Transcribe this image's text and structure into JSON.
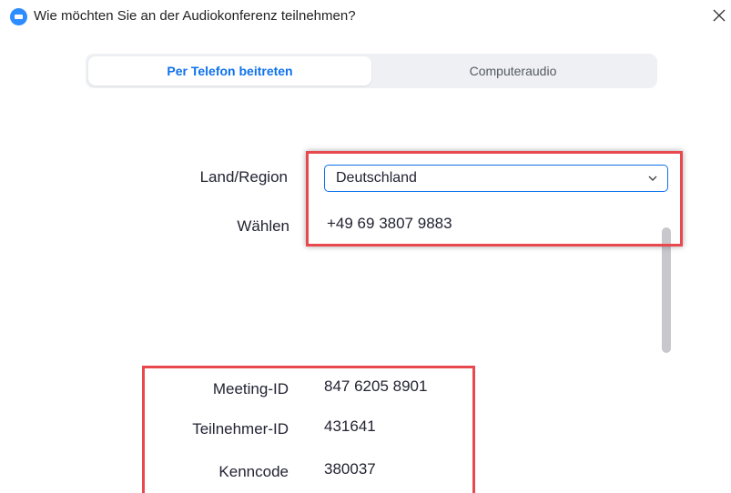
{
  "window": {
    "title": "Wie möchten Sie an der Audiokonferenz teilnehmen?",
    "app_icon": "zoom-logo-icon",
    "close_icon": "close-icon"
  },
  "tabs": [
    {
      "label": "Per Telefon beitreten",
      "active": true
    },
    {
      "label": "Computeraudio",
      "active": false
    }
  ],
  "dial_in": {
    "country_label": "Land/Region",
    "country_value": "Deutschland",
    "dial_label": "Wählen",
    "dial_number": "+49 69 3807 9883"
  },
  "meeting_info": {
    "meeting_id_label": "Meeting-ID",
    "meeting_id": "847 6205 8901",
    "participant_id_label": "Teilnehmer-ID",
    "participant_id": "431641",
    "passcode_label": "Kenncode",
    "passcode": "380037"
  },
  "colors": {
    "accent": "#0e71eb",
    "highlight": "#e8494f",
    "tab_background": "#eef0f3"
  }
}
